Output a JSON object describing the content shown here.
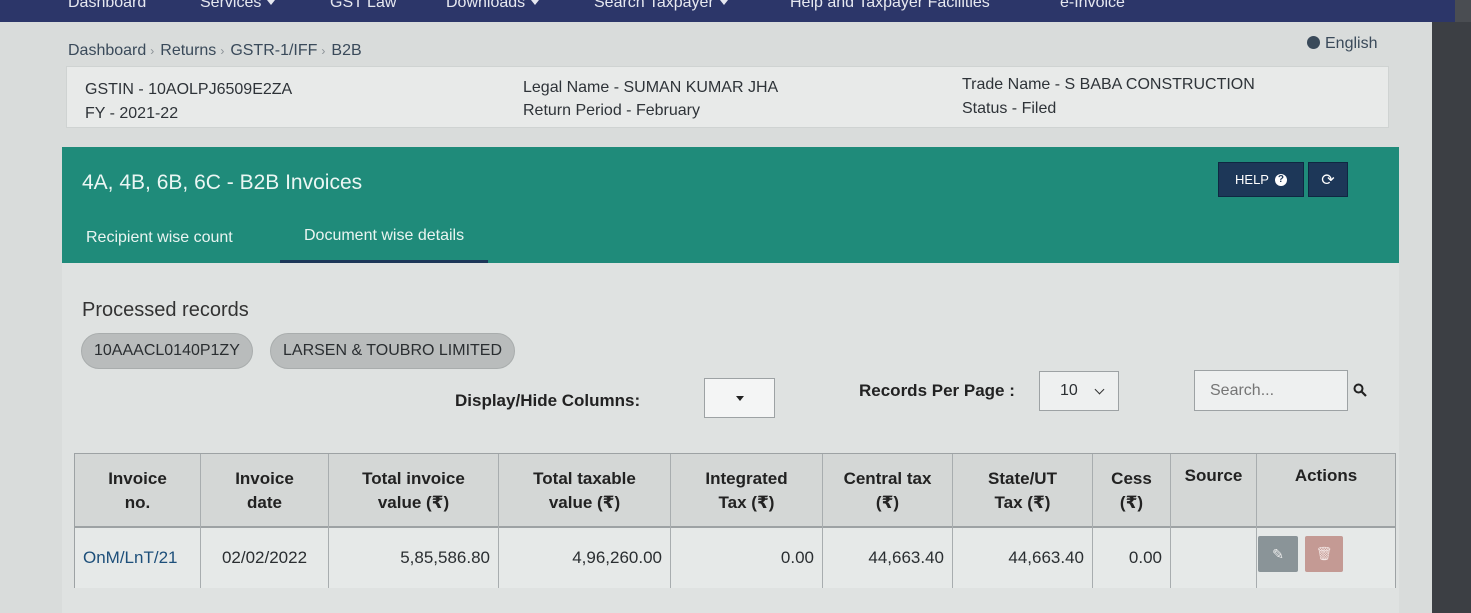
{
  "nav": {
    "items": [
      {
        "label": "Dashboard",
        "has_caret": false
      },
      {
        "label": "Services",
        "has_caret": true
      },
      {
        "label": "GST Law",
        "has_caret": false
      },
      {
        "label": "Downloads",
        "has_caret": true
      },
      {
        "label": "Search Taxpayer",
        "has_caret": true
      },
      {
        "label": "Help and Taxpayer Facilities",
        "has_caret": false
      },
      {
        "label": "e-Invoice",
        "has_caret": false
      }
    ]
  },
  "breadcrumb": [
    "Dashboard",
    "Returns",
    "GSTR-1/IFF",
    "B2B"
  ],
  "language": "English",
  "info": {
    "gstin": "GSTIN - 10AOLPJ6509E2ZA",
    "fy": "FY - 2021-22",
    "legal_name": "Legal Name - SUMAN KUMAR JHA",
    "return_period": "Return Period - February",
    "trade_name": "Trade Name - S BABA CONSTRUCTION",
    "status": "Status - Filed"
  },
  "panel": {
    "title": "4A, 4B, 6B, 6C - B2B Invoices",
    "help_label": "HELP",
    "tabs": [
      "Recipient wise count",
      "Document wise details"
    ],
    "active_tab": 1
  },
  "processed": {
    "heading": "Processed records",
    "chips": [
      "10AAACL0140P1ZY",
      "LARSEN & TOUBRO LIMITED"
    ]
  },
  "controls": {
    "display_hide_label": "Display/Hide Columns:",
    "records_per_page_label": "Records Per Page :",
    "records_per_page_value": "10",
    "search_placeholder": "Search..."
  },
  "table": {
    "headers": [
      [
        "Invoice",
        "no."
      ],
      [
        "Invoice",
        "date"
      ],
      [
        "Total invoice",
        "value (₹)"
      ],
      [
        "Total taxable",
        "value (₹)"
      ],
      [
        "Integrated",
        "Tax (₹)"
      ],
      [
        "Central tax",
        "(₹)"
      ],
      [
        "State/UT",
        "Tax (₹)"
      ],
      [
        "Cess",
        "(₹)"
      ],
      [
        "Source",
        ""
      ],
      [
        "Actions",
        ""
      ]
    ],
    "rows": [
      [
        "OnM/LnT/21",
        "02/02/2022",
        "5,85,586.80",
        "4,96,260.00",
        "0.00",
        "44,663.40",
        "44,663.40",
        "0.00",
        ""
      ]
    ]
  }
}
